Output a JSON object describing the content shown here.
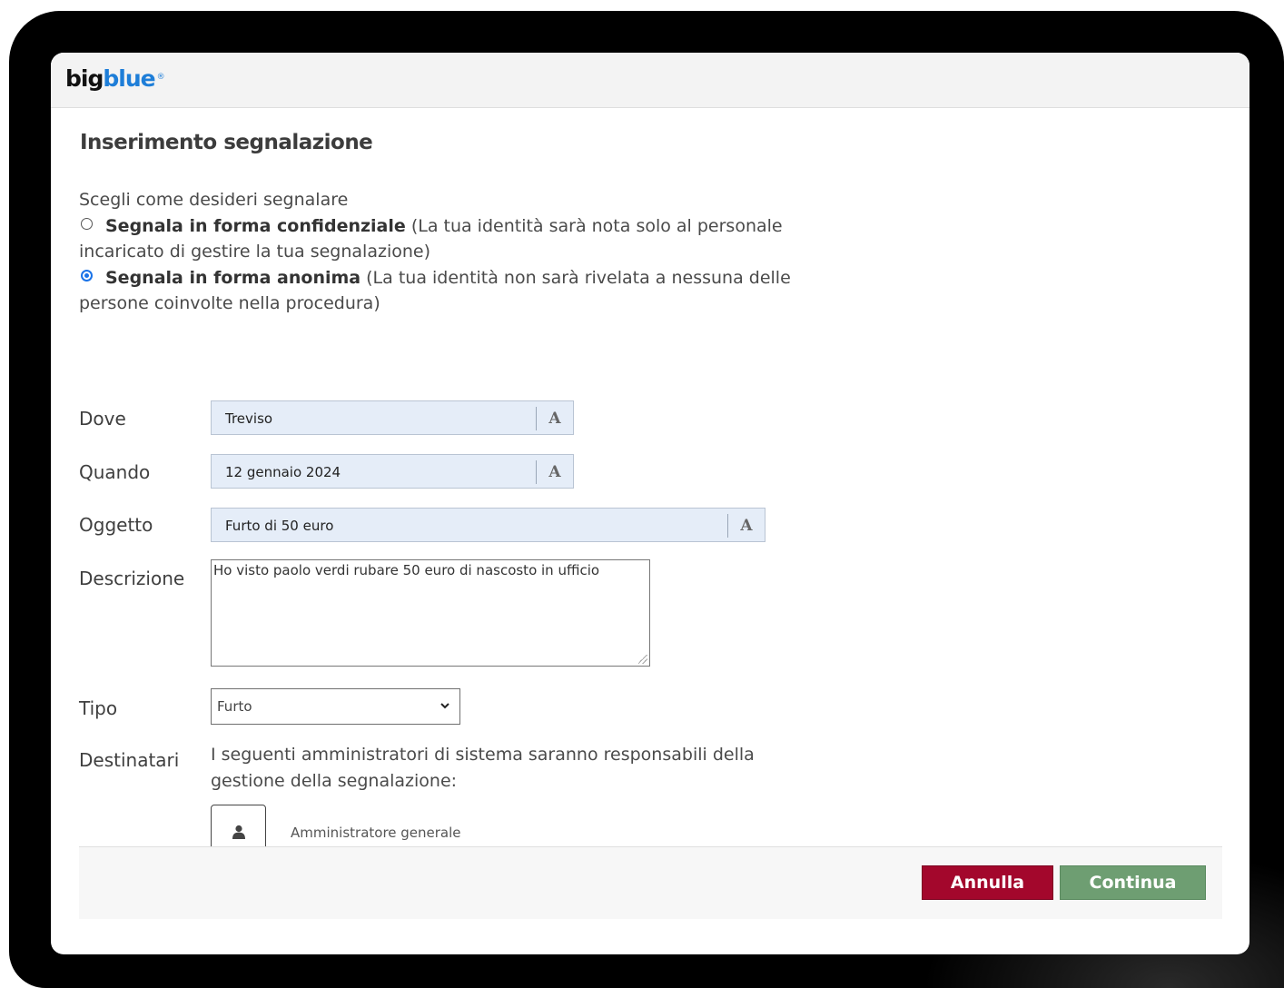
{
  "app": {
    "logo_big": "big",
    "logo_blue": "blue",
    "logo_mark": "®"
  },
  "page": {
    "title": "Inserimento segnalazione"
  },
  "report_mode": {
    "prompt": "Scegli come desideri segnalare",
    "options": [
      {
        "label": "Segnala in forma confidenziale",
        "description": " (La tua identità sarà nota solo al personale incaricato di gestire la tua segnalazione)",
        "selected": false
      },
      {
        "label": "Segnala in forma anonima",
        "description": " (La tua identità non sarà rivelata a nessuna delle persone coinvolte nella procedura)",
        "selected": true
      }
    ]
  },
  "form": {
    "dove": {
      "label": "Dove",
      "value": "Treviso",
      "format_button": "A"
    },
    "quando": {
      "label": "Quando",
      "value": "12 gennaio 2024",
      "format_button": "A"
    },
    "oggetto": {
      "label": "Oggetto",
      "value": "Furto di 50 euro",
      "format_button": "A"
    },
    "descrizione": {
      "label": "Descrizione",
      "value": "Ho visto paolo verdi rubare 50 euro di nascosto in ufficio"
    },
    "tipo": {
      "label": "Tipo",
      "selected": "Furto"
    },
    "destinatari": {
      "label": "Destinatari",
      "text": "I seguenti amministratori di sistema saranno responsabili della gestione della segnalazione:",
      "admins": [
        {
          "name": "Amministratore generale",
          "icon": "user-icon"
        }
      ]
    }
  },
  "actions": {
    "cancel_label": "Annulla",
    "continue_label": "Continua"
  },
  "colors": {
    "logo_blue": "#1e7ed8",
    "cancel_button": "#a3072c",
    "continue_button": "#6e9e72",
    "input_background": "#e5edf8",
    "radio_selected": "#1a73e8"
  }
}
